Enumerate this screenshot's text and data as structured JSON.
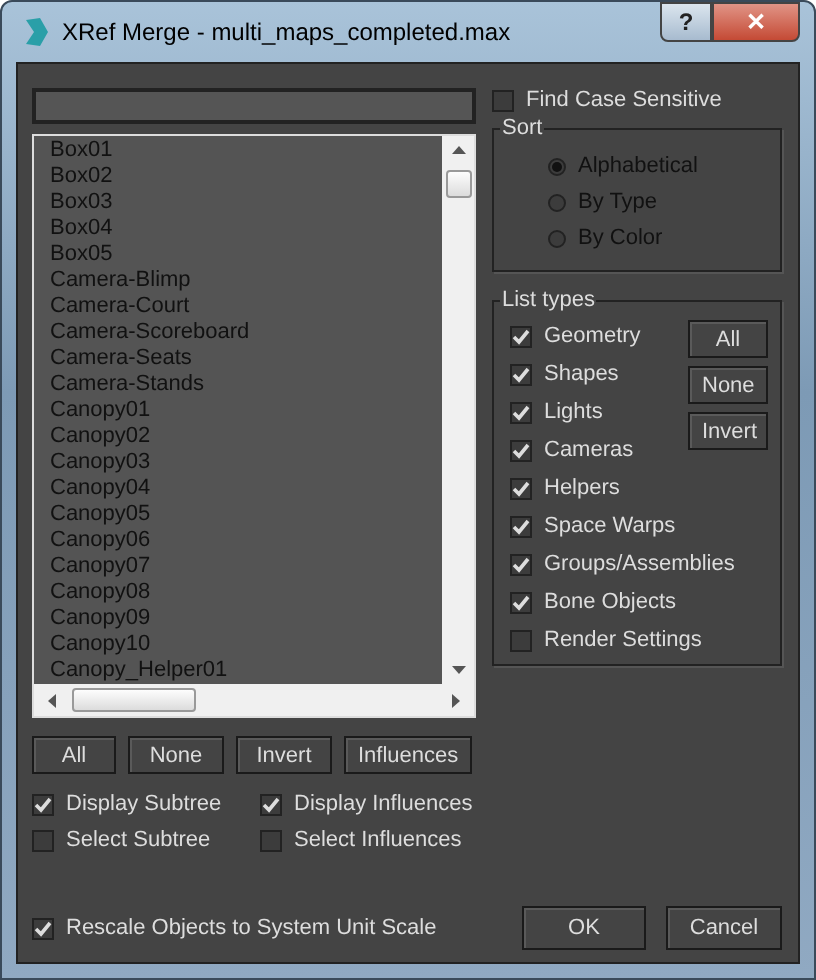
{
  "window": {
    "title": "XRef Merge - multi_maps_completed.max",
    "buttons": [
      "?",
      "✕"
    ]
  },
  "object_list": [
    "Box01",
    "Box02",
    "Box03",
    "Box04",
    "Box05",
    "Camera-Blimp",
    "Camera-Court",
    "Camera-Scoreboard",
    "Camera-Seats",
    "Camera-Stands",
    "Canopy01",
    "Canopy02",
    "Canopy03",
    "Canopy04",
    "Canopy05",
    "Canopy06",
    "Canopy07",
    "Canopy08",
    "Canopy09",
    "Canopy10",
    "Canopy_Helper01"
  ],
  "find_case_sensitive": {
    "label": "Find Case Sensitive",
    "checked": false
  },
  "sort": {
    "title": "Sort",
    "options": [
      {
        "label": "Alphabetical",
        "selected": true
      },
      {
        "label": "By Type",
        "selected": false
      },
      {
        "label": "By Color",
        "selected": false
      }
    ]
  },
  "list_types": {
    "title": "List types",
    "items": [
      {
        "label": "Geometry",
        "checked": true
      },
      {
        "label": "Shapes",
        "checked": true
      },
      {
        "label": "Lights",
        "checked": true
      },
      {
        "label": "Cameras",
        "checked": true
      },
      {
        "label": "Helpers",
        "checked": true
      },
      {
        "label": "Space Warps",
        "checked": true
      },
      {
        "label": "Groups/Assemblies",
        "checked": true
      },
      {
        "label": "Bone Objects",
        "checked": true
      },
      {
        "label": "Render Settings",
        "checked": false
      }
    ],
    "buttons": [
      "All",
      "None",
      "Invert"
    ]
  },
  "list_buttons": [
    "All",
    "None",
    "Invert",
    "Influences"
  ],
  "options": [
    {
      "label": "Display Subtree",
      "checked": true
    },
    {
      "label": "Display Influences",
      "checked": true
    },
    {
      "label": "Select Subtree",
      "checked": false
    },
    {
      "label": "Select Influences",
      "checked": false
    }
  ],
  "rescale": {
    "label": "Rescale Objects to System Unit Scale",
    "checked": true
  },
  "dialog_buttons": [
    "OK",
    "Cancel"
  ]
}
